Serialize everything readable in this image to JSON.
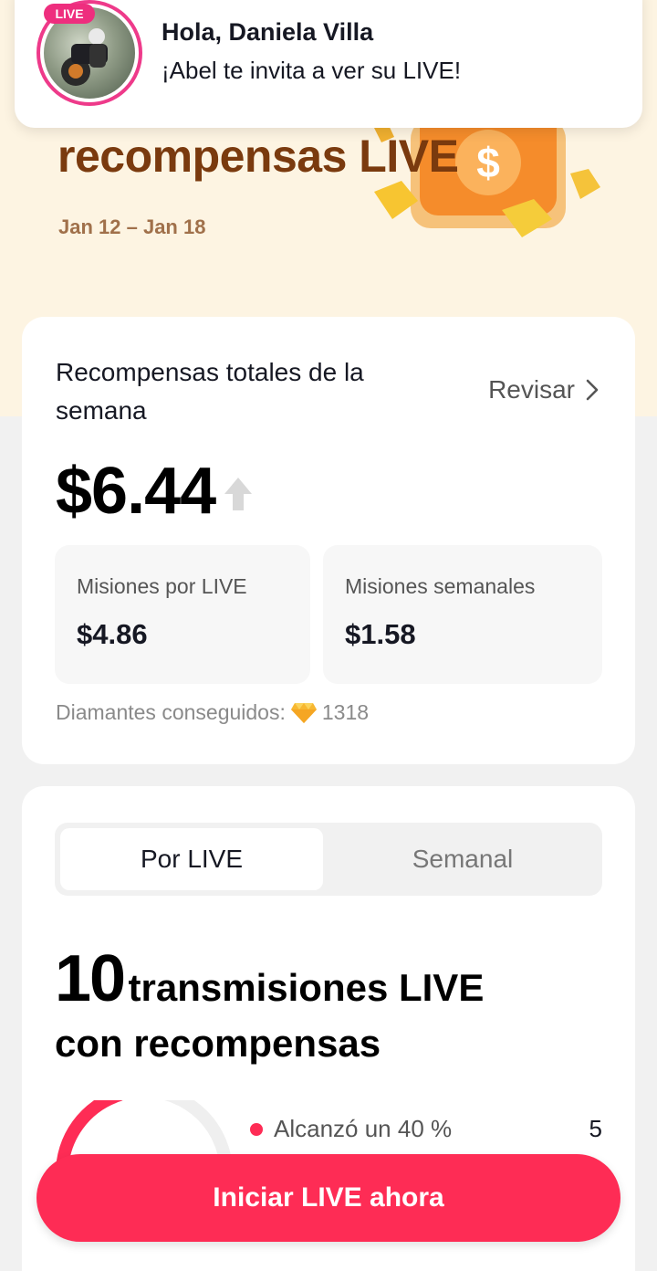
{
  "notification": {
    "badge": "LIVE",
    "title": "Hola, Daniela Villa",
    "message": "¡Abel te invita a ver su LIVE!"
  },
  "hero": {
    "title": "recompensas LIVE",
    "dates": "Jan 12 – Jan 18"
  },
  "summary": {
    "title": "Recompensas totales de la semana",
    "review_label": "Revisar",
    "total": "$6.44",
    "live_missions_label": "Misiones por LIVE",
    "live_missions_value": "$4.86",
    "weekly_missions_label": "Misiones semanales",
    "weekly_missions_value": "$1.58",
    "diamonds_label": "Diamantes conseguidos:",
    "diamonds_value": "1318"
  },
  "missions": {
    "tab_active": "Por LIVE",
    "tab_inactive": "Semanal",
    "count": "10",
    "headline_rest": "transmisiones LIVE",
    "headline_line2": "con recompensas",
    "legend_label": "Alcanzó un 40 %",
    "legend_count": "5",
    "progress_fraction": 0.4
  },
  "cta_label": "Iniciar LIVE ahora",
  "colors": {
    "accent": "#fe2c55",
    "live_pink": "#ee2e7e",
    "hero_bg": "#fdf4e2",
    "hero_title": "#7a3a0e"
  }
}
